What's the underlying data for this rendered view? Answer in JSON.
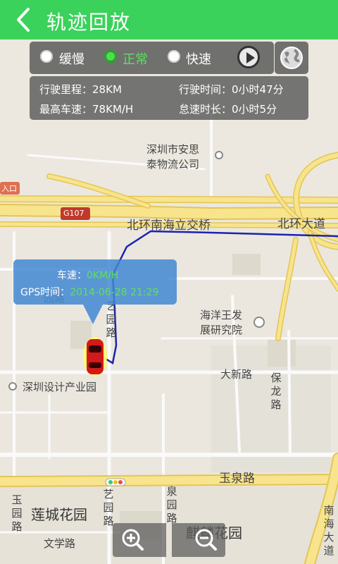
{
  "header": {
    "title": "轨迹回放"
  },
  "speed_options": [
    {
      "label": "缓慢",
      "selected": false
    },
    {
      "label": "正常",
      "selected": true
    },
    {
      "label": "快速",
      "selected": false
    }
  ],
  "stats": {
    "mileage_label": "行驶里程：",
    "mileage_value": "28KM",
    "time_label": "行驶时间：",
    "time_value": "0小时47分",
    "maxspeed_label": "最高车速：",
    "maxspeed_value": "78KM/H",
    "idle_label": "怠速时长：",
    "idle_value": "0小时5分"
  },
  "info_bubble": {
    "speed_label": "车速：",
    "speed_value": "0KM/H",
    "gps_label": "GPS时间：",
    "gps_value": "2014-06-28 21:29"
  },
  "map_labels": {
    "poi1_line1": "深圳市安思",
    "poi1_line2": "泰物流公司",
    "entrance": "入口",
    "g107": "G107",
    "road_beihuan_nanhai": "北环南海立交桥",
    "road_beihuan_dadao": "北环大道",
    "poi2_line1": "海洋王发",
    "poi2_line2": "展研究院",
    "road_daxin": "大新路",
    "road_baolong": "保龙路",
    "poi_design_park": "深圳设计产业园",
    "road_yuquan": "玉泉路",
    "road_yiyuan_upper": "艺园路",
    "road_yiyuan_lower": "艺园路",
    "road_quanyuan": "泉园路",
    "road_yuyuan": "玉园路",
    "poi_liancheng": "莲城花园",
    "poi_qilin": "麒麟花园",
    "road_wenxue": "文学路",
    "road_nanhai_dadao": "南海大道",
    "road_yuan": "园路"
  },
  "colors": {
    "header_bg": "#3ad25a",
    "accent_green": "#5ee05e",
    "track_blue": "#1a23b0",
    "bubble_bg": "#4287d2"
  },
  "icons": {
    "back": "chevron-left-icon",
    "play": "play-icon",
    "globe": "globe-icon",
    "zoom_in": "zoom-in-icon",
    "zoom_out": "zoom-out-icon",
    "car": "car-icon"
  }
}
